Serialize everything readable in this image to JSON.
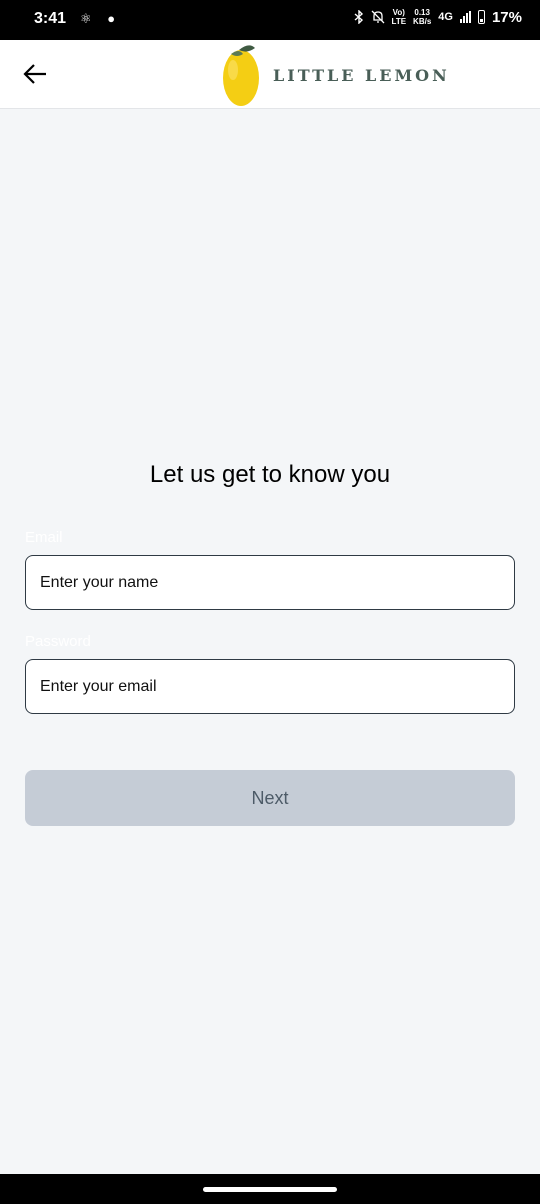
{
  "status_bar": {
    "time": "3:41",
    "left_icons": "⚛︎ ●",
    "volte": [
      "Vo)",
      "LTE"
    ],
    "net_speed": [
      "0.13",
      "KB/s"
    ],
    "network": "4G",
    "battery": "17%"
  },
  "header": {
    "logo_text": "LITTLE LEMON",
    "back_icon": "arrow-left-icon"
  },
  "main": {
    "heading": "Let us get to know you",
    "fields": [
      {
        "label": "Email",
        "placeholder": "Enter your name"
      },
      {
        "label": "Password",
        "placeholder": "Enter your email"
      }
    ],
    "next_label": "Next"
  },
  "colors": {
    "background": "#f4f6f8",
    "button_disabled": "#c5ccd6",
    "brand_green": "#495e57",
    "lemon": "#f4ce14"
  }
}
